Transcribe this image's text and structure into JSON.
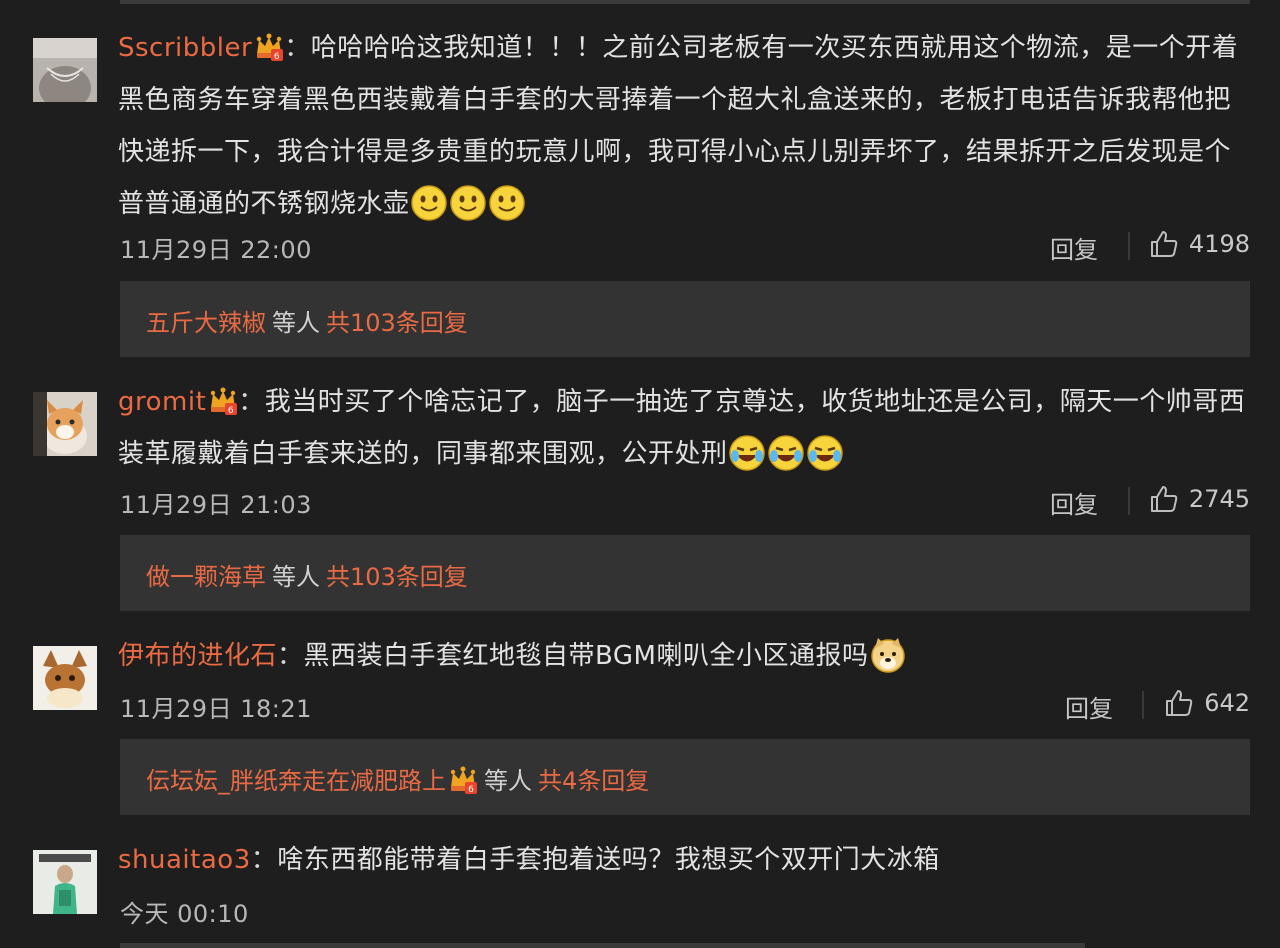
{
  "comments": [
    {
      "username": "Sscribbler",
      "separator": "：",
      "text": "哈哈哈哈这我知道！！！之前公司老板有一次买东西就用这个物流，是一个开着黑色商务车穿着黑色西装戴着白手套的大哥捧着一个超大礼盒送来的，老板打电话告诉我帮他把快递拆一下，我合计得是多贵重的玩意儿啊，我可得小心点儿别弄坏了，结果拆开之后发现是个普普通通的不锈钢烧水壶",
      "emojis": [
        "smile-emoji",
        "smile-emoji",
        "smile-emoji"
      ],
      "time": "11月29日 22:00",
      "reply_label": "回复",
      "likes": "4198",
      "replies_preview": {
        "name": "五斤大辣椒",
        "etc": "等人",
        "count": "共103条回复"
      }
    },
    {
      "username": "gromit",
      "separator": "：",
      "text": "我当时买了个啥忘记了，脑子一抽选了京尊达，收货地址还是公司，隔天一个帅哥西装革履戴着白手套来送的，同事都来围观，公开处刑",
      "emojis": [
        "laugh-cry-emoji",
        "laugh-cry-emoji",
        "laugh-cry-emoji"
      ],
      "time": "11月29日 21:03",
      "reply_label": "回复",
      "likes": "2745",
      "replies_preview": {
        "name": "做一颗海草",
        "etc": "等人",
        "count": "共103条回复"
      }
    },
    {
      "username": "伊布的进化石",
      "separator": "：",
      "text": "黑西装白手套红地毯自带BGM喇叭全小区通报吗",
      "emojis": [
        "doge-emoji"
      ],
      "time": "11月29日 18:21",
      "reply_label": "回复",
      "likes": "642",
      "replies_preview": {
        "name": "伝坛妘_胖纸奔走在减肥路上",
        "etc": "等人",
        "count": "共4条回复"
      }
    },
    {
      "username": "shuaitao3",
      "separator": "：",
      "text": "啥东西都能带着白手套抱着送吗？我想买个双开门大冰箱",
      "time": "今天 00:10"
    }
  ],
  "colors": {
    "background": "#1e1e1e",
    "username": "#e96a43",
    "text": "#e2e2e2",
    "meta": "#b8b8b8",
    "reply_box": "#333333"
  }
}
